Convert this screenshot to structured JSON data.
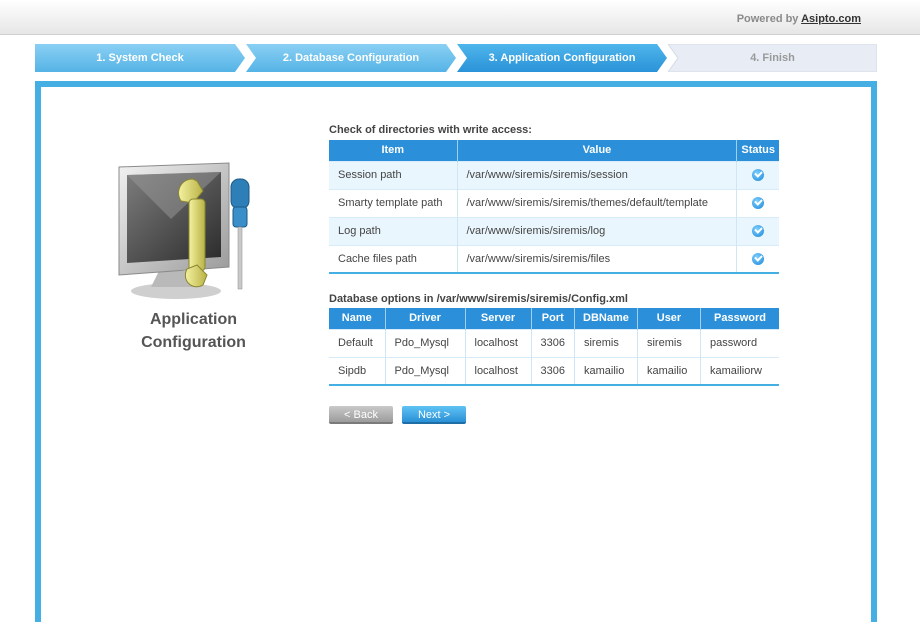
{
  "header": {
    "powered_prefix": "Powered by",
    "powered_link": "Asipto.com"
  },
  "steps": [
    {
      "label": "1. System Check",
      "state": "done"
    },
    {
      "label": "2. Database Configuration",
      "state": "done"
    },
    {
      "label": "3. Application Configuration",
      "state": "active"
    },
    {
      "label": "4. Finish",
      "state": "pending"
    }
  ],
  "section": {
    "title_line1": "Application",
    "title_line2": "Configuration"
  },
  "directories": {
    "caption": "Check of directories with write access:",
    "headers": [
      "Item",
      "Value",
      "Status"
    ],
    "rows": [
      {
        "item": "Session path",
        "value": "/var/www/siremis/siremis/session",
        "status": "ok"
      },
      {
        "item": "Smarty template path",
        "value": "/var/www/siremis/siremis/themes/default/template",
        "status": "ok"
      },
      {
        "item": "Log path",
        "value": "/var/www/siremis/siremis/log",
        "status": "ok"
      },
      {
        "item": "Cache files path",
        "value": "/var/www/siremis/siremis/files",
        "status": "ok"
      }
    ]
  },
  "database": {
    "caption": "Database options in /var/www/siremis/siremis/Config.xml",
    "headers": [
      "Name",
      "Driver",
      "Server",
      "Port",
      "DBName",
      "User",
      "Password"
    ],
    "rows": [
      [
        "Default",
        "Pdo_Mysql",
        "localhost",
        "3306",
        "siremis",
        "siremis",
        "password"
      ],
      [
        "Sipdb",
        "Pdo_Mysql",
        "localhost",
        "3306",
        "kamailio",
        "kamailio",
        "kamailiorw"
      ]
    ]
  },
  "buttons": {
    "back": "< Back",
    "next": "Next >"
  },
  "colors": {
    "accent": "#45aee3",
    "header_blue": "#2b90d9",
    "step_pending": "#e8edf5"
  },
  "icons": [
    "check-circle-icon",
    "computer-tools-icon"
  ]
}
